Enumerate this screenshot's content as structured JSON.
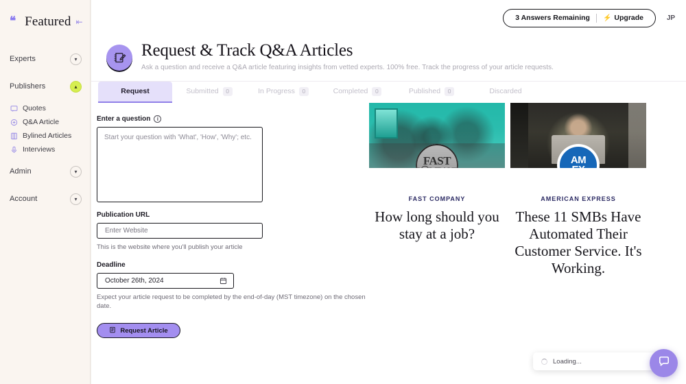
{
  "sidebar": {
    "brand": "Featured",
    "collapse_icon": "collapse-left-icon",
    "groups": [
      {
        "label": "Experts",
        "state": "collapsed",
        "chevron": "chevron-down-icon"
      },
      {
        "label": "Publishers",
        "state": "expanded",
        "chevron": "chevron-up-icon",
        "accent": "#d6ee50"
      }
    ],
    "sub_items": [
      {
        "label": "Quotes",
        "icon": "quotes-icon"
      },
      {
        "label": "Q&A Article",
        "icon": "qa-article-icon"
      },
      {
        "label": "Bylined Articles",
        "icon": "bylined-articles-icon"
      },
      {
        "label": "Interviews",
        "icon": "microphone-icon"
      }
    ],
    "footer_groups": [
      {
        "label": "Admin",
        "state": "collapsed",
        "chevron": "chevron-down-icon"
      },
      {
        "label": "Account",
        "state": "collapsed",
        "chevron": "chevron-down-icon"
      }
    ]
  },
  "topbar": {
    "answers_remaining": "3 Answers Remaining",
    "upgrade_label": "Upgrade",
    "upgrade_icon": "bolt-icon",
    "avatar_initials": "JP"
  },
  "header": {
    "icon": "notepad-pencil-icon",
    "title": "Request & Track Q&A Articles",
    "subtitle": "Ask a question and receive a Q&A article featuring insights from vetted experts. 100% free. Track the progress of your article requests.",
    "accent": "#a794ef"
  },
  "tabs": [
    {
      "label": "Request",
      "count": null,
      "active": true
    },
    {
      "label": "Submitted",
      "count": "0",
      "active": false
    },
    {
      "label": "In Progress",
      "count": "0",
      "active": false
    },
    {
      "label": "Completed",
      "count": "0",
      "active": false
    },
    {
      "label": "Published",
      "count": "0",
      "active": false
    },
    {
      "label": "Discarded",
      "count": null,
      "active": false
    }
  ],
  "form": {
    "question_label": "Enter a question",
    "question_info_icon": "info-icon",
    "question_placeholder": "Start your question with 'What', 'How', 'Why'; etc.",
    "question_value": "",
    "url_label": "Publication URL",
    "url_placeholder": "Enter Website",
    "url_value": "",
    "url_helper": "This is the website where you'll publish your article",
    "deadline_label": "Deadline",
    "deadline_value": "October 26th, 2024",
    "deadline_icon": "calendar-icon",
    "deadline_helper": "Expect your article request to be completed by the end-of-day (MST timezone) on the chosen date.",
    "submit_label": "Request Article",
    "submit_icon": "article-icon",
    "submit_color": "#a38ef0"
  },
  "cards": [
    {
      "brand": "FAST COMPANY",
      "logo": "fast-company-logo",
      "headline": "How long should you stay at a job?",
      "image_alt": "people meeting in teal room"
    },
    {
      "brand": "AMERICAN EXPRESS",
      "logo": "amex-logo",
      "headline": "These 11 SMBs Have Automated Their Customer Service. It's Working.",
      "image_alt": "man working on laptop"
    }
  ],
  "chat": {
    "loading_text": "Loading...",
    "spinner_icon": "spinner-icon",
    "bubble_icon": "chat-bubble-icon",
    "bubble_color": "#9b87e8"
  }
}
